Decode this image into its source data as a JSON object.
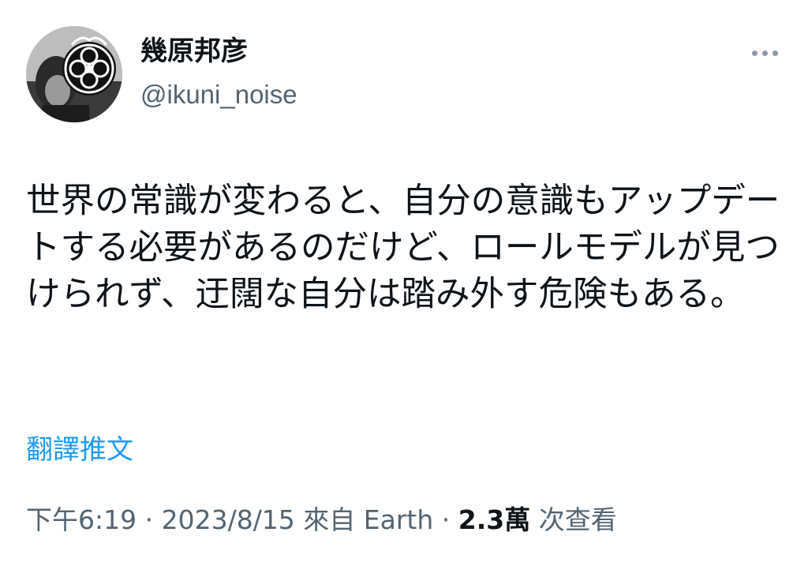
{
  "user": {
    "display_name": "幾原邦彦",
    "handle": "@ikuni_noise",
    "avatar_icon": "profile-avatar-emblem"
  },
  "more_icon": "more-horizontal-icon",
  "tweet": {
    "text": "世界の常識が変わると、自分の意識もアップデートする必要があるのだけど、ロールモデルが見つけられず、迂闊な自分は踏み外す危険もある。"
  },
  "translate_label": "翻譯推文",
  "meta": {
    "time": "下午6:19",
    "separator1": " · ",
    "date": "2023/8/15",
    "source": " 來自 Earth",
    "separator2": " · ",
    "views_count": "2.3萬",
    "views_label": " 次查看"
  },
  "colors": {
    "link": "#1d9bf0",
    "secondary_text": "#536471",
    "primary_text": "#0f1419"
  }
}
